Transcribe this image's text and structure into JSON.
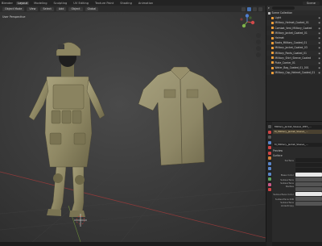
{
  "topbar": {
    "app_menu": "Blender",
    "workspaces": [
      "Layout",
      "Modeling",
      "Sculpting",
      "UV Editing",
      "Texture Paint",
      "Shading",
      "Animation"
    ],
    "active_workspace": "Layout",
    "scene_label": "Scene"
  },
  "viewport_header": {
    "mode": "Object Mode",
    "menus": [
      "View",
      "Select",
      "Add",
      "Object"
    ],
    "transform": "Global",
    "shading_buttons": 4
  },
  "viewport": {
    "overlay_label": "User Perspective"
  },
  "outliner": {
    "title": "Scene Collection",
    "rows": [
      {
        "label": "Scene Collection",
        "depth": 0,
        "kind": "scn"
      },
      {
        "label": "Light",
        "depth": 1,
        "kind": "obj"
      },
      {
        "label": "Military_Helmet_Coated_01",
        "depth": 1,
        "kind": "obj"
      },
      {
        "label": "Combat_Vest_Military_Coated",
        "depth": 1,
        "kind": "obj"
      },
      {
        "label": "Military_Jacket_Coated_01",
        "depth": 1,
        "kind": "obj"
      },
      {
        "label": "Helmet",
        "depth": 1,
        "kind": "obj"
      },
      {
        "label": "Boots_Military_Coated_01",
        "depth": 1,
        "kind": "obj"
      },
      {
        "label": "Military_Jacket_Coated_03",
        "depth": 1,
        "kind": "obj"
      },
      {
        "label": "Military_Pants_Coated_01",
        "depth": 1,
        "kind": "obj"
      },
      {
        "label": "Military_Shirt_Sleeve_Coated",
        "depth": 1,
        "kind": "obj"
      },
      {
        "label": "Plate_Carrier_01",
        "depth": 1,
        "kind": "obj"
      },
      {
        "label": "Water_Bag_Coated_01_001",
        "depth": 1,
        "kind": "obj"
      },
      {
        "label": "Military_Cap_Helmet_Coated_01",
        "depth": 1,
        "kind": "obj"
      }
    ]
  },
  "properties": {
    "object_name": "Military_Jacket_Sleeve_With_...",
    "material_slot": "M_Military_Jacket_Sleeve_...",
    "material_field": "M_Military_Jacket_Sleeve_...",
    "sections": [
      "Preview",
      "Surface"
    ],
    "rows": [
      {
        "label": "Surface",
        "style": "dark"
      },
      {
        "label": "",
        "style": "dark"
      },
      {
        "label": "",
        "style": "dark"
      },
      {
        "label": "Base Color",
        "style": "sw"
      },
      {
        "label": "Subsurface",
        "style": "normal"
      },
      {
        "label": "Subsurface Radius",
        "style": "normal"
      },
      {
        "label": "",
        "style": "normal"
      },
      {
        "label": "Subsurface Color",
        "style": "sw"
      },
      {
        "label": "Subsurface IOR",
        "style": "normal"
      },
      {
        "label": "Subsurface Anisotropy",
        "style": "normal"
      }
    ]
  }
}
